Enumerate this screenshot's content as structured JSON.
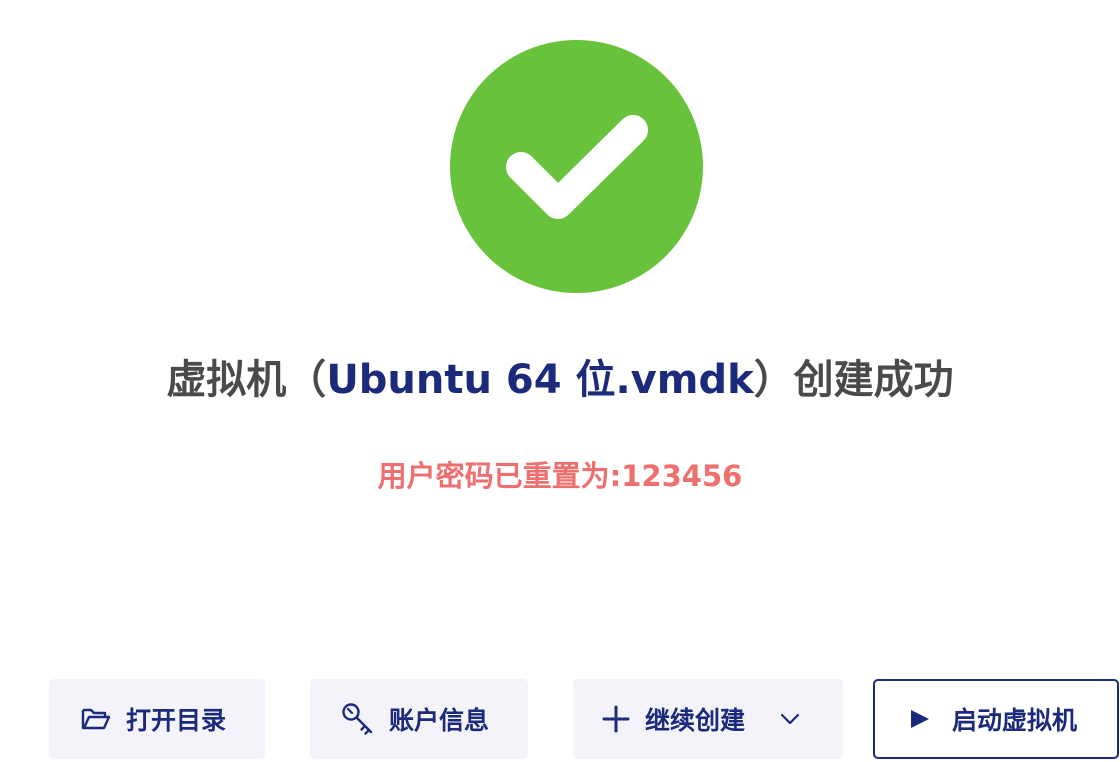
{
  "result": {
    "icon": "check-circle-icon",
    "color": "#68c23b",
    "title_prefix": "虚拟机（",
    "title_vm_name": "Ubuntu 64 位.vmdk",
    "title_suffix": "）创建成功",
    "password_note": "用户密码已重置为:123456",
    "accent_color": "#1b2a7a",
    "note_color": "#ef6f6f"
  },
  "actions": {
    "open_directory": {
      "label": "打开目录",
      "icon": "folder-open-icon"
    },
    "account_info": {
      "label": "账户信息",
      "icon": "key-icon"
    },
    "continue_create": {
      "label": "继续创建",
      "icon": "plus-icon",
      "dropdown_icon": "chevron-down-icon"
    },
    "start_vm": {
      "label": "启动虚拟机",
      "icon": "play-icon"
    }
  }
}
